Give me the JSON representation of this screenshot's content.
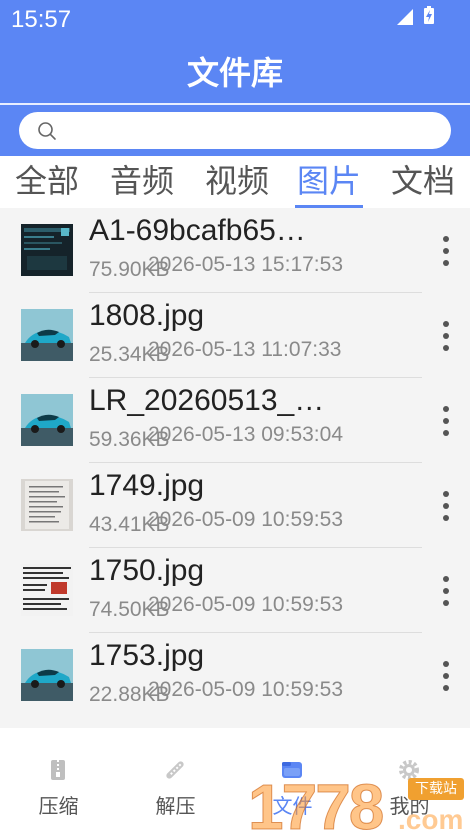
{
  "status_bar": {
    "time": "15:57"
  },
  "header": {
    "title": "文件库"
  },
  "search": {
    "placeholder": ""
  },
  "tabs": [
    {
      "label": "全部",
      "active": false
    },
    {
      "label": "音频",
      "active": false
    },
    {
      "label": "视频",
      "active": false
    },
    {
      "label": "图片",
      "active": true
    },
    {
      "label": "文档",
      "active": false
    }
  ],
  "files": [
    {
      "name": "A1-69bcafb65…",
      "size": "75.90KB",
      "date": "2026-05-13 15:17:53",
      "thumb": "dark-screenshot"
    },
    {
      "name": "1808.jpg",
      "size": "25.34KB",
      "date": "2026-05-13 11:07:33",
      "thumb": "blue-car"
    },
    {
      "name": "LR_20260513_…",
      "size": "59.36KB",
      "date": "2026-05-13 09:53:04",
      "thumb": "blue-car"
    },
    {
      "name": "1749.jpg",
      "size": "43.41KB",
      "date": "2026-05-09 10:59:53",
      "thumb": "text-document"
    },
    {
      "name": "1750.jpg",
      "size": "74.50KB",
      "date": "2026-05-09 10:59:53",
      "thumb": "text-screenshot"
    },
    {
      "name": "1753.jpg",
      "size": "22.88KB",
      "date": "2026-05-09 10:59:53",
      "thumb": "blue-car"
    }
  ],
  "bottom_nav": [
    {
      "label": "压缩",
      "icon": "compress-icon",
      "active": false
    },
    {
      "label": "解压",
      "icon": "unzip-icon",
      "active": false
    },
    {
      "label": "文件",
      "icon": "files-icon",
      "active": true
    },
    {
      "label": "我的",
      "icon": "settings-icon",
      "active": false
    }
  ],
  "watermark": {
    "digits": "1778",
    "tag": "下载站",
    "suffix": ".com"
  },
  "colors": {
    "primary": "#5b86f4",
    "list_bg": "#f4f4f4",
    "text_secondary": "#8a8a8a"
  }
}
